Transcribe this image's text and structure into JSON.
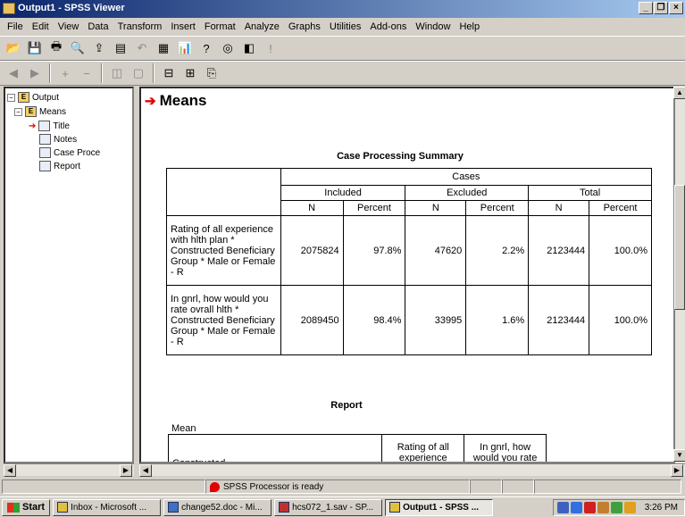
{
  "window": {
    "title": "Output1 - SPSS Viewer",
    "min": "_",
    "restore": "❐",
    "close": "×"
  },
  "menus": [
    "File",
    "Edit",
    "View",
    "Data",
    "Transform",
    "Insert",
    "Format",
    "Analyze",
    "Graphs",
    "Utilities",
    "Add-ons",
    "Window",
    "Help"
  ],
  "outline": {
    "root": "Output",
    "means": "Means",
    "title": "Title",
    "notes": "Notes",
    "case_proc": "Case Proce",
    "report": "Report"
  },
  "content": {
    "heading": "Means",
    "case_summary": {
      "title": "Case Processing Summary",
      "cases_header": "Cases",
      "groups": [
        "Included",
        "Excluded",
        "Total"
      ],
      "subheaders": [
        "N",
        "Percent",
        "N",
        "Percent",
        "N",
        "Percent"
      ],
      "rows": [
        {
          "label": "Rating of all experience with hlth plan  * Constructed Beneficiary Group * Male or Female  - R",
          "values": [
            "2075824",
            "97.8%",
            "47620",
            "2.2%",
            "2123444",
            "100.0%"
          ]
        },
        {
          "label": "In gnrl, how would you rate ovrall hlth  * Constructed Beneficiary Group * Male or Female  - R",
          "values": [
            "2089450",
            "98.4%",
            "33995",
            "1.6%",
            "2123444",
            "100.0%"
          ]
        }
      ]
    },
    "report": {
      "title": "Report",
      "subtitle": "Mean",
      "col0": "Constructed",
      "col1": "Rating of all experience",
      "col2": "In gnrl, how would you rate"
    }
  },
  "status": {
    "text": "SPSS Processor  is ready"
  },
  "taskbar": {
    "start": "Start",
    "tasks": [
      "Inbox - Microsoft ...",
      "change52.doc - Mi...",
      "hcs072_1.sav - SP...",
      "Output1 - SPSS ..."
    ],
    "active_index": 3,
    "clock": "3:26 PM"
  }
}
